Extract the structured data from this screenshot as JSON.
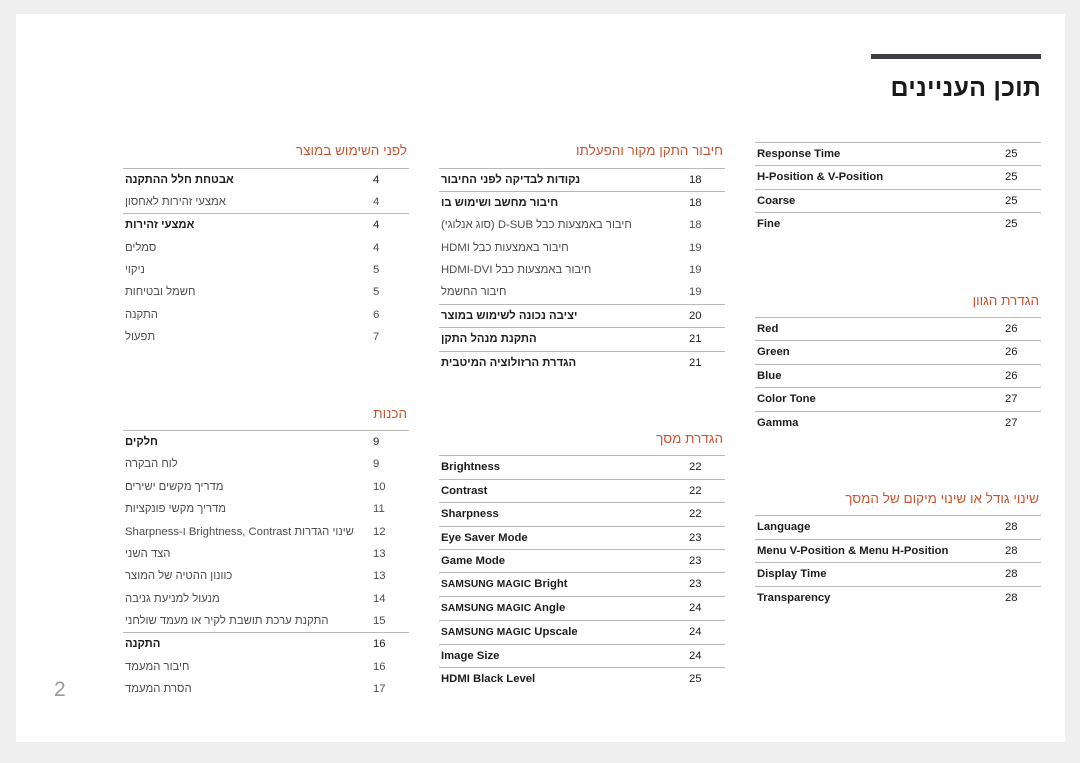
{
  "document": {
    "title": "תוכן העניינים",
    "page_number": "2",
    "accent_color": "#c9542f",
    "rule_color": "#3e4046",
    "page_background": "#ffffff",
    "canvas_background": "#efeff0"
  },
  "columns": [
    {
      "name": "column-left",
      "sections": [
        {
          "title": null,
          "groups": [
            {
              "rows": [
                {
                  "label": "Response Time",
                  "page": "25",
                  "lead": true,
                  "ltr": true
                }
              ]
            },
            {
              "rows": [
                {
                  "label": "H-Position & V-Position",
                  "page": "25",
                  "lead": true,
                  "ltr": true
                }
              ]
            },
            {
              "rows": [
                {
                  "label": "Coarse",
                  "page": "25",
                  "lead": true,
                  "ltr": true
                }
              ]
            },
            {
              "rows": [
                {
                  "label": "Fine",
                  "page": "25",
                  "lead": true,
                  "ltr": true
                }
              ]
            }
          ]
        },
        {
          "title": "הגדרת הגוון",
          "spacer": true,
          "groups": [
            {
              "rows": [
                {
                  "label": "Red",
                  "page": "26",
                  "lead": true,
                  "ltr": true
                }
              ]
            },
            {
              "rows": [
                {
                  "label": "Green",
                  "page": "26",
                  "lead": true,
                  "ltr": true
                }
              ]
            },
            {
              "rows": [
                {
                  "label": "Blue",
                  "page": "26",
                  "lead": true,
                  "ltr": true
                }
              ]
            },
            {
              "rows": [
                {
                  "label": "Color Tone",
                  "page": "27",
                  "lead": true,
                  "ltr": true
                }
              ]
            },
            {
              "rows": [
                {
                  "label": "Gamma",
                  "page": "27",
                  "lead": true,
                  "ltr": true
                }
              ]
            }
          ]
        },
        {
          "title": "שינוי גודל או שינוי מיקום של המסך",
          "spacer": true,
          "groups": [
            {
              "rows": [
                {
                  "label": "Language",
                  "page": "28",
                  "lead": true,
                  "ltr": true
                }
              ]
            },
            {
              "rows": [
                {
                  "label": "Menu V-Position & Menu H-Position",
                  "page": "28",
                  "lead": true,
                  "ltr": true
                }
              ]
            },
            {
              "rows": [
                {
                  "label": "Display Time",
                  "page": "28",
                  "lead": true,
                  "ltr": true
                }
              ]
            },
            {
              "rows": [
                {
                  "label": "Transparency",
                  "page": "28",
                  "lead": true,
                  "ltr": true
                }
              ]
            }
          ]
        }
      ]
    },
    {
      "name": "column-middle",
      "sections": [
        {
          "title": "חיבור התקן מקור והפעלתו",
          "groups": [
            {
              "rows": [
                {
                  "label": "נקודות לבדיקה לפני החיבור",
                  "page": "18",
                  "lead": true,
                  "ltr": false
                }
              ]
            },
            {
              "rows": [
                {
                  "label": "חיבור מחשב ושימוש בו",
                  "page": "18",
                  "lead": true,
                  "ltr": false
                },
                {
                  "label": "חיבור באמצעות כבל D-SUB (סוג אנלוגי)",
                  "page": "18",
                  "lead": false,
                  "ltr": false
                },
                {
                  "label": "חיבור באמצעות כבל HDMI",
                  "page": "19",
                  "lead": false,
                  "ltr": false
                },
                {
                  "label": "חיבור באמצעות כבל HDMI-DVI",
                  "page": "19",
                  "lead": false,
                  "ltr": false
                },
                {
                  "label": "חיבור החשמל",
                  "page": "19",
                  "lead": false,
                  "ltr": false
                }
              ]
            },
            {
              "rows": [
                {
                  "label": "יציבה נכונה לשימוש במוצר",
                  "page": "20",
                  "lead": true,
                  "ltr": false
                }
              ]
            },
            {
              "rows": [
                {
                  "label": "התקנת מנהל התקן",
                  "page": "21",
                  "lead": true,
                  "ltr": false
                }
              ]
            },
            {
              "rows": [
                {
                  "label": "הגדרת הרזולוציה המיטבית",
                  "page": "21",
                  "lead": true,
                  "ltr": false
                }
              ]
            }
          ]
        },
        {
          "title": "הגדרת מסך",
          "spacer": true,
          "groups": [
            {
              "rows": [
                {
                  "label": "Brightness",
                  "page": "22",
                  "lead": true,
                  "ltr": true
                }
              ]
            },
            {
              "rows": [
                {
                  "label": "Contrast",
                  "page": "22",
                  "lead": true,
                  "ltr": true
                }
              ]
            },
            {
              "rows": [
                {
                  "label": "Sharpness",
                  "page": "22",
                  "lead": true,
                  "ltr": true
                }
              ]
            },
            {
              "rows": [
                {
                  "label": "Eye Saver Mode",
                  "page": "23",
                  "lead": true,
                  "ltr": true
                }
              ]
            },
            {
              "rows": [
                {
                  "label": "Game Mode",
                  "page": "23",
                  "lead": true,
                  "ltr": true
                }
              ]
            },
            {
              "rows": [
                {
                  "label": "SAMSUNG MAGIC Bright",
                  "page": "23",
                  "lead": true,
                  "ltr": true,
                  "smallcaps_prefix": "SAMSUNG MAGIC",
                  "suffix": "Bright"
                }
              ]
            },
            {
              "rows": [
                {
                  "label": "SAMSUNG MAGIC Angle",
                  "page": "24",
                  "lead": true,
                  "ltr": true,
                  "smallcaps_prefix": "SAMSUNG MAGIC",
                  "suffix": "Angle"
                }
              ]
            },
            {
              "rows": [
                {
                  "label": "SAMSUNG MAGIC Upscale",
                  "page": "24",
                  "lead": true,
                  "ltr": true,
                  "smallcaps_prefix": "SAMSUNG MAGIC",
                  "suffix": "Upscale"
                }
              ]
            },
            {
              "rows": [
                {
                  "label": "Image Size",
                  "page": "24",
                  "lead": true,
                  "ltr": true
                }
              ]
            },
            {
              "rows": [
                {
                  "label": "HDMI Black Level",
                  "page": "25",
                  "lead": true,
                  "ltr": true
                }
              ]
            }
          ]
        }
      ]
    },
    {
      "name": "column-right",
      "sections": [
        {
          "title": "לפני השימוש במוצר",
          "groups": [
            {
              "rows": [
                {
                  "label": "אבטחת חלל ההתקנה",
                  "page": "4",
                  "lead": true,
                  "ltr": false
                },
                {
                  "label": "אמצעי זהירות לאחסון",
                  "page": "4",
                  "lead": false,
                  "ltr": false
                }
              ]
            },
            {
              "rows": [
                {
                  "label": "אמצעי זהירות",
                  "page": "4",
                  "lead": true,
                  "ltr": false
                },
                {
                  "label": "סמלים",
                  "page": "4",
                  "lead": false,
                  "ltr": false
                },
                {
                  "label": "ניקוי",
                  "page": "5",
                  "lead": false,
                  "ltr": false
                },
                {
                  "label": "חשמל ובטיחות",
                  "page": "5",
                  "lead": false,
                  "ltr": false
                },
                {
                  "label": "התקנה",
                  "page": "6",
                  "lead": false,
                  "ltr": false
                },
                {
                  "label": "תפעול",
                  "page": "7",
                  "lead": false,
                  "ltr": false
                }
              ]
            }
          ]
        },
        {
          "title": "הכנות",
          "spacer": true,
          "groups": [
            {
              "rows": [
                {
                  "label": "חלקים",
                  "page": "9",
                  "lead": true,
                  "ltr": false
                },
                {
                  "label": "לוח הבקרה",
                  "page": "9",
                  "lead": false,
                  "ltr": false
                },
                {
                  "label": "מדריך מקשים ישירים",
                  "page": "10",
                  "lead": false,
                  "ltr": false
                },
                {
                  "label": "מדריך מקשי פונקציות",
                  "page": "11",
                  "lead": false,
                  "ltr": false
                },
                {
                  "label": "שינוי הגדרות Brightness, Contrast ו-Sharpness",
                  "page": "12",
                  "lead": false,
                  "ltr": false
                },
                {
                  "label": "הצד השני",
                  "page": "13",
                  "lead": false,
                  "ltr": false
                },
                {
                  "label": "כוונון ההטיה של המוצר",
                  "page": "13",
                  "lead": false,
                  "ltr": false
                },
                {
                  "label": "מנעול למניעת גניבה",
                  "page": "14",
                  "lead": false,
                  "ltr": false
                },
                {
                  "label": "התקנת ערכת תושבת לקיר או מעמד שולחני",
                  "page": "15",
                  "lead": false,
                  "ltr": false
                }
              ]
            },
            {
              "rows": [
                {
                  "label": "התקנה",
                  "page": "16",
                  "lead": true,
                  "ltr": false
                },
                {
                  "label": "חיבור המעמד",
                  "page": "16",
                  "lead": false,
                  "ltr": false
                },
                {
                  "label": "הסרת המעמד",
                  "page": "17",
                  "lead": false,
                  "ltr": false
                }
              ]
            }
          ]
        }
      ]
    }
  ]
}
